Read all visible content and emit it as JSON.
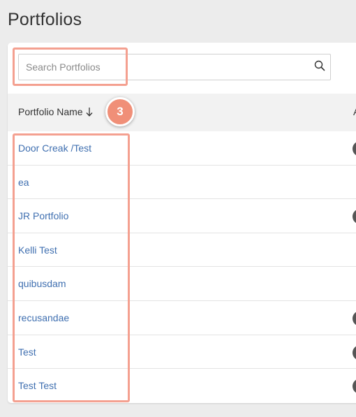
{
  "page": {
    "title": "Portfolios"
  },
  "search": {
    "placeholder": "Search Portfolios",
    "value": "",
    "icon": "search-icon"
  },
  "table": {
    "columns": [
      {
        "label": "Portfolio Name",
        "sort": "descending",
        "sort_icon": "arrow-down-icon"
      },
      {
        "label": "A"
      }
    ],
    "rows": [
      {
        "name": "Door Creak /Test",
        "indicator": true
      },
      {
        "name": "ea",
        "indicator": false
      },
      {
        "name": "JR Portfolio",
        "indicator": true
      },
      {
        "name": "Kelli Test",
        "indicator": false
      },
      {
        "name": "quibusdam",
        "indicator": false
      },
      {
        "name": "recusandae",
        "indicator": true
      },
      {
        "name": "Test",
        "indicator": true
      },
      {
        "name": "Test Test",
        "indicator": true
      }
    ]
  },
  "annotation": {
    "step_number": "3",
    "highlight_color": "#f4a090",
    "badge_color": "#f08f78"
  },
  "colors": {
    "link": "#3f6fb0",
    "header_bg": "#f2f2f2",
    "page_bg": "#ececec"
  }
}
